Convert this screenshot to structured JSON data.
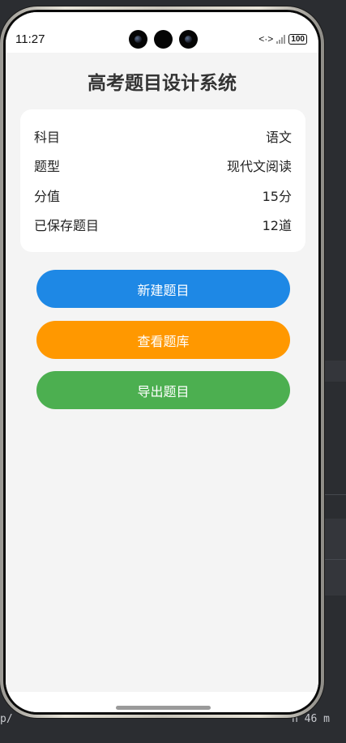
{
  "status_bar": {
    "time": "11:27",
    "network": "<·>",
    "battery": "100"
  },
  "app": {
    "title": "高考题目设计系统",
    "info": [
      {
        "label": "科目",
        "value": "语文"
      },
      {
        "label": "题型",
        "value": "现代文阅读"
      },
      {
        "label": "分值",
        "value": "15分"
      },
      {
        "label": "已保存题目",
        "value": "12道"
      }
    ],
    "buttons": {
      "new_question": "新建题目",
      "view_bank": "查看题库",
      "export": "导出题目"
    }
  },
  "colors": {
    "new_button": "#1e88e5",
    "view_button": "#ff9800",
    "export_button": "#4caf50",
    "page_bg": "#f4f4f4",
    "card_bg": "#ffffff"
  },
  "background": {
    "bottom_left_text": "p/",
    "bottom_right_text": "n 46 m"
  }
}
